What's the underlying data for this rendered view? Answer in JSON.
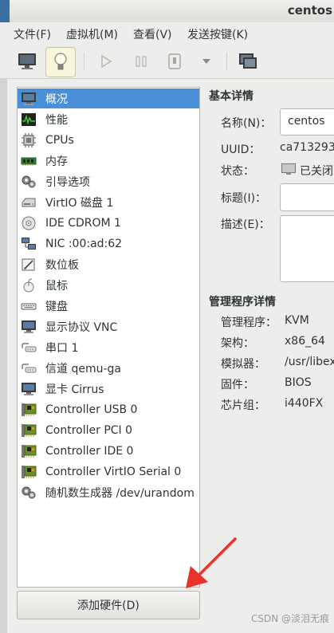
{
  "window": {
    "title": "centos"
  },
  "menu": [
    "文件(F)",
    "虚拟机(M)",
    "查看(V)",
    "发送按键(K)"
  ],
  "toolbar": {
    "buttons": [
      "monitor-icon",
      "lightbulb-icon",
      "play-icon",
      "pause-icon",
      "power-icon",
      "dropdown-icon",
      "fullscreen-icon"
    ]
  },
  "hardware": [
    {
      "label": "概况",
      "icon": "overview-icon"
    },
    {
      "label": "性能",
      "icon": "performance-icon"
    },
    {
      "label": "CPUs",
      "icon": "cpu-icon"
    },
    {
      "label": "内存",
      "icon": "memory-icon"
    },
    {
      "label": "引导选项",
      "icon": "boot-gear-icon"
    },
    {
      "label": "VirtIO 磁盘 1",
      "icon": "disk-icon"
    },
    {
      "label": "IDE CDROM 1",
      "icon": "cdrom-icon"
    },
    {
      "label": "NIC :00:ad:62",
      "icon": "nic-icon"
    },
    {
      "label": "数位板",
      "icon": "tablet-icon"
    },
    {
      "label": "鼠标",
      "icon": "mouse-icon"
    },
    {
      "label": "键盘",
      "icon": "keyboard-icon"
    },
    {
      "label": "显示协议  VNC",
      "icon": "display-icon"
    },
    {
      "label": "串口 1",
      "icon": "serial-icon"
    },
    {
      "label": "信道  qemu-ga",
      "icon": "channel-icon"
    },
    {
      "label": "显卡  Cirrus",
      "icon": "video-icon"
    },
    {
      "label": "Controller USB 0",
      "icon": "controller-icon"
    },
    {
      "label": "Controller PCI 0",
      "icon": "controller-icon"
    },
    {
      "label": "Controller IDE 0",
      "icon": "controller-icon"
    },
    {
      "label": "Controller VirtIO Serial 0",
      "icon": "controller-icon"
    },
    {
      "label": "随机数生成器  /dev/urandom",
      "icon": "rng-gear-icon"
    }
  ],
  "add_hardware_label": "添加硬件(D)",
  "basic": {
    "title": "基本详情",
    "name_label": "名称(N)：",
    "name_value": "centos",
    "uuid_label": "UUID：",
    "uuid_value": "ca713293-",
    "state_label": "状态：",
    "state_value": "已关闭",
    "title_label": "标题(I)：",
    "title_value": "",
    "desc_label": "描述(E)：",
    "desc_value": ""
  },
  "hypervisor": {
    "title": "管理程序详情",
    "rows": [
      {
        "label": "管理程序：",
        "value": "KVM"
      },
      {
        "label": "架构：",
        "value": "x86_64"
      },
      {
        "label": "模拟器：",
        "value": "/usr/libex"
      },
      {
        "label": "固件：",
        "value": "BIOS"
      },
      {
        "label": "芯片组：",
        "value": "i440FX"
      }
    ]
  },
  "watermark": "CSDN @淡泪无痕",
  "colors": {
    "selection": "#4a90d9",
    "arrow": "#e8332a"
  }
}
